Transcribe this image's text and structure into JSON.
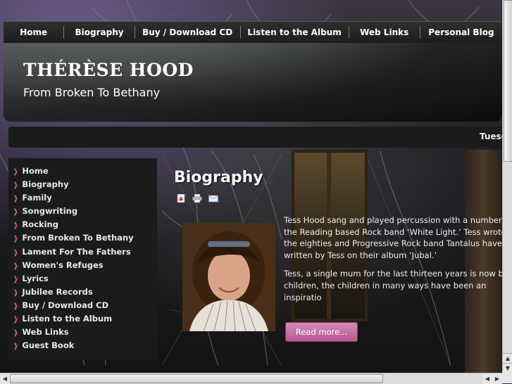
{
  "nav": {
    "items": [
      {
        "label": "Home"
      },
      {
        "label": "Biography"
      },
      {
        "label": "Buy / Download CD"
      },
      {
        "label": "Listen to the Album"
      },
      {
        "label": "Web Links"
      },
      {
        "label": "Personal Blog"
      }
    ]
  },
  "header": {
    "title": "THÉRÈSE HOOD",
    "tagline": "From Broken To Bethany"
  },
  "datebar": {
    "date": "Tuesd"
  },
  "sidebar": {
    "items": [
      {
        "label": "Home"
      },
      {
        "label": "Biography"
      },
      {
        "label": "Family"
      },
      {
        "label": "Songwriting"
      },
      {
        "label": "Rocking"
      },
      {
        "label": "From Broken To Bethany"
      },
      {
        "label": "Lament For The Fathers"
      },
      {
        "label": "Women's Refuges"
      },
      {
        "label": "Lyrics"
      },
      {
        "label": "Jubilee Records"
      },
      {
        "label": "Buy / Download CD"
      },
      {
        "label": "Listen to the Album"
      },
      {
        "label": "Web Links"
      },
      {
        "label": "Guest Book"
      }
    ]
  },
  "content": {
    "heading": "Biography",
    "paragraphs": [
      "Tess Hood sang and played percussion with a number of the Reading based Rock band ‘White Light.’ Tess wrote l the eighties and Progressive Rock band Tantalus have co written by Tess on their album ‘Jubal.’",
      "Tess, a single mum for the last thirteen years is now b children, the children in many ways have been an inspiratio"
    ],
    "read_more": "Read more..."
  },
  "colors": {
    "accent": "#c94f8a",
    "button": "#c96b9f"
  }
}
